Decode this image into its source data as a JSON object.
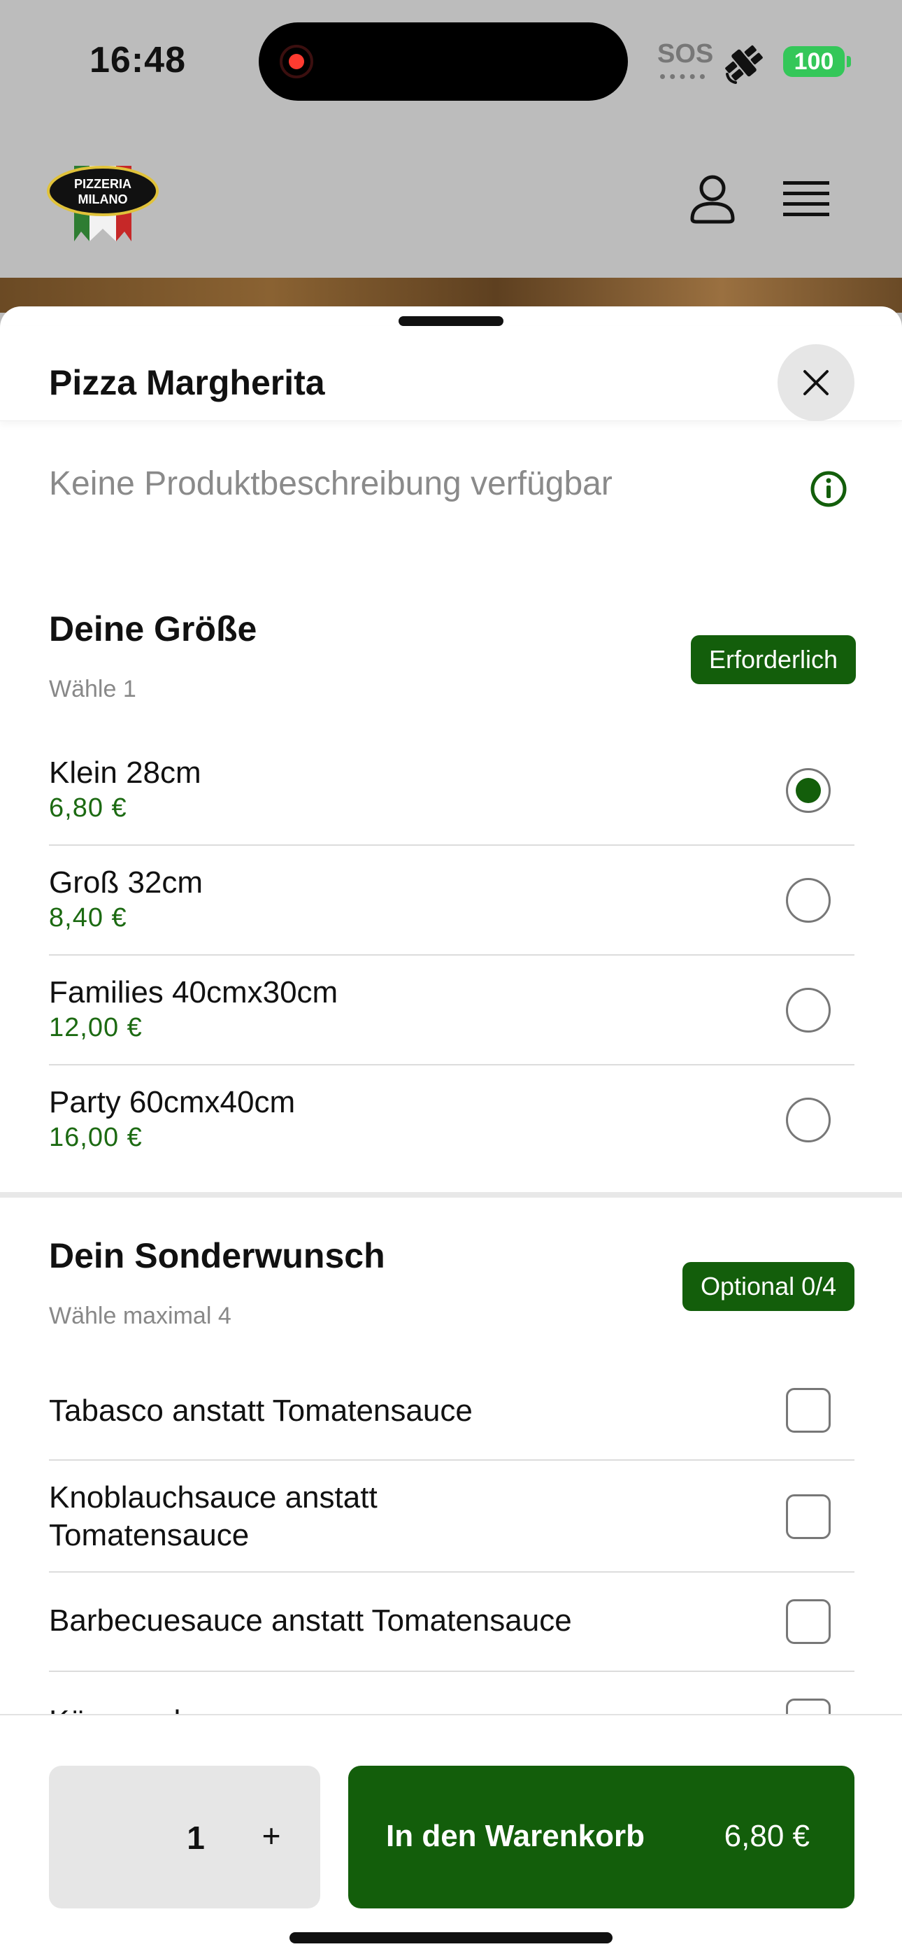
{
  "status_bar": {
    "time": "16:48",
    "sos": "SOS",
    "battery": "100",
    "icons": [
      "record-icon",
      "satellite-icon",
      "battery-icon"
    ]
  },
  "header": {
    "logo_line1": "PIZZERIA",
    "logo_line2": "MILANO",
    "icons": [
      "user-icon",
      "hamburger-menu-icon"
    ]
  },
  "sheet": {
    "title": "Pizza Margherita",
    "description": "Keine Produktbeschreibung verfügbar",
    "close_icon": "close-icon",
    "info_icon": "info-icon"
  },
  "size_section": {
    "title": "Deine Größe",
    "subtitle": "Wähle 1",
    "badge": "Erforderlich",
    "options": [
      {
        "label": "Klein 28cm",
        "price": "6,80 €",
        "selected": true
      },
      {
        "label": "Groß 32cm",
        "price": "8,40 €",
        "selected": false
      },
      {
        "label": "Families 40cmx30cm",
        "price": "12,00 €",
        "selected": false
      },
      {
        "label": "Party 60cmx40cm",
        "price": "16,00 €",
        "selected": false
      }
    ]
  },
  "wish_section": {
    "title": "Dein Sonderwunsch",
    "subtitle": "Wähle maximal 4",
    "badge": "Optional 0/4",
    "options": [
      {
        "label": "Tabasco anstatt Tomatensauce",
        "checked": false
      },
      {
        "label": "Knoblauchsauce anstatt Tomatensauce",
        "checked": false
      },
      {
        "label": "Barbecuesauce anstatt Tomatensauce",
        "checked": false
      },
      {
        "label": "Käserand",
        "checked": false
      }
    ]
  },
  "bottom_bar": {
    "quantity": "1",
    "plus": "+",
    "cart_label": "In den Warenkorb",
    "cart_price": "6,80 €"
  },
  "colors": {
    "accent": "#135e0b",
    "price": "#1c6a12",
    "battery": "#34c759",
    "backdrop": "#bcbcbc"
  }
}
